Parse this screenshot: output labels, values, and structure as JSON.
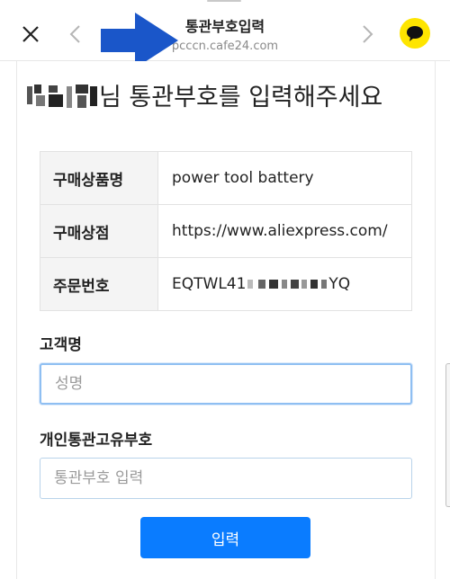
{
  "header": {
    "title": "통관부호입력",
    "url": "pcccn.cafe24.com",
    "close_icon": "close-icon",
    "back_icon": "chevron-left-icon",
    "forward_icon": "chevron-right-icon",
    "share_icon": "kakao-talk-icon",
    "share_color": "#fee500",
    "arrow_color": "#1a56c9"
  },
  "main": {
    "heading_suffix": "님 통관부호를 입력해주세요",
    "order_info": [
      {
        "label": "구매상품명",
        "value": "power tool battery"
      },
      {
        "label": "구매상점",
        "value": "https://www.aliexpress.com/"
      },
      {
        "label": "주문번호",
        "value_prefix": "EQTWL41",
        "value_suffix": "YQ"
      }
    ],
    "customer_name_label": "고객명",
    "customer_name_placeholder": "성명",
    "customs_code_label": "개인통관고유부호",
    "customs_code_placeholder": "통관부호 입력",
    "submit_label": "입력",
    "submit_color": "#0a7cff"
  }
}
